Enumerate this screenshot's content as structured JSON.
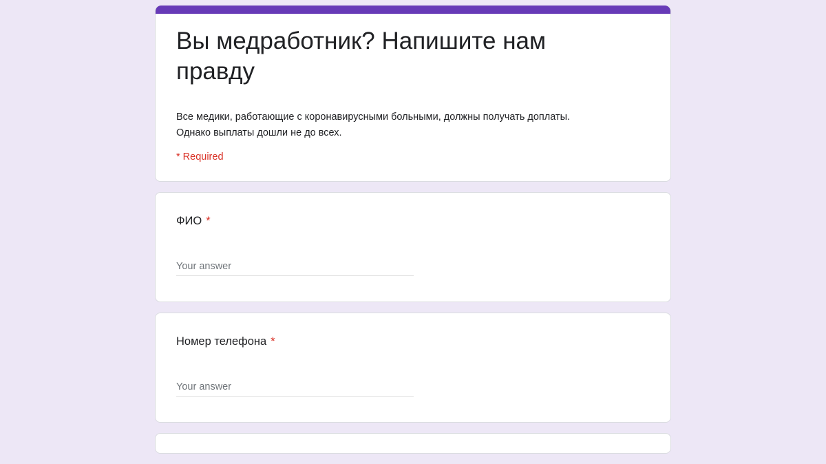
{
  "form": {
    "title": "Вы медработник? Напишите нам правду",
    "description_line1": "Все медики, работающие с коронавирусными больными, должны получать доплаты.",
    "description_line2": "Однако выплаты дошли не до всех.",
    "required_note": "* Required",
    "accent_color": "#673ab7",
    "background_color": "#ede7f6"
  },
  "questions": [
    {
      "title": "ФИО",
      "required_mark": "*",
      "placeholder": "Your answer"
    },
    {
      "title": "Номер телефона",
      "required_mark": "*",
      "placeholder": "Your answer"
    }
  ]
}
